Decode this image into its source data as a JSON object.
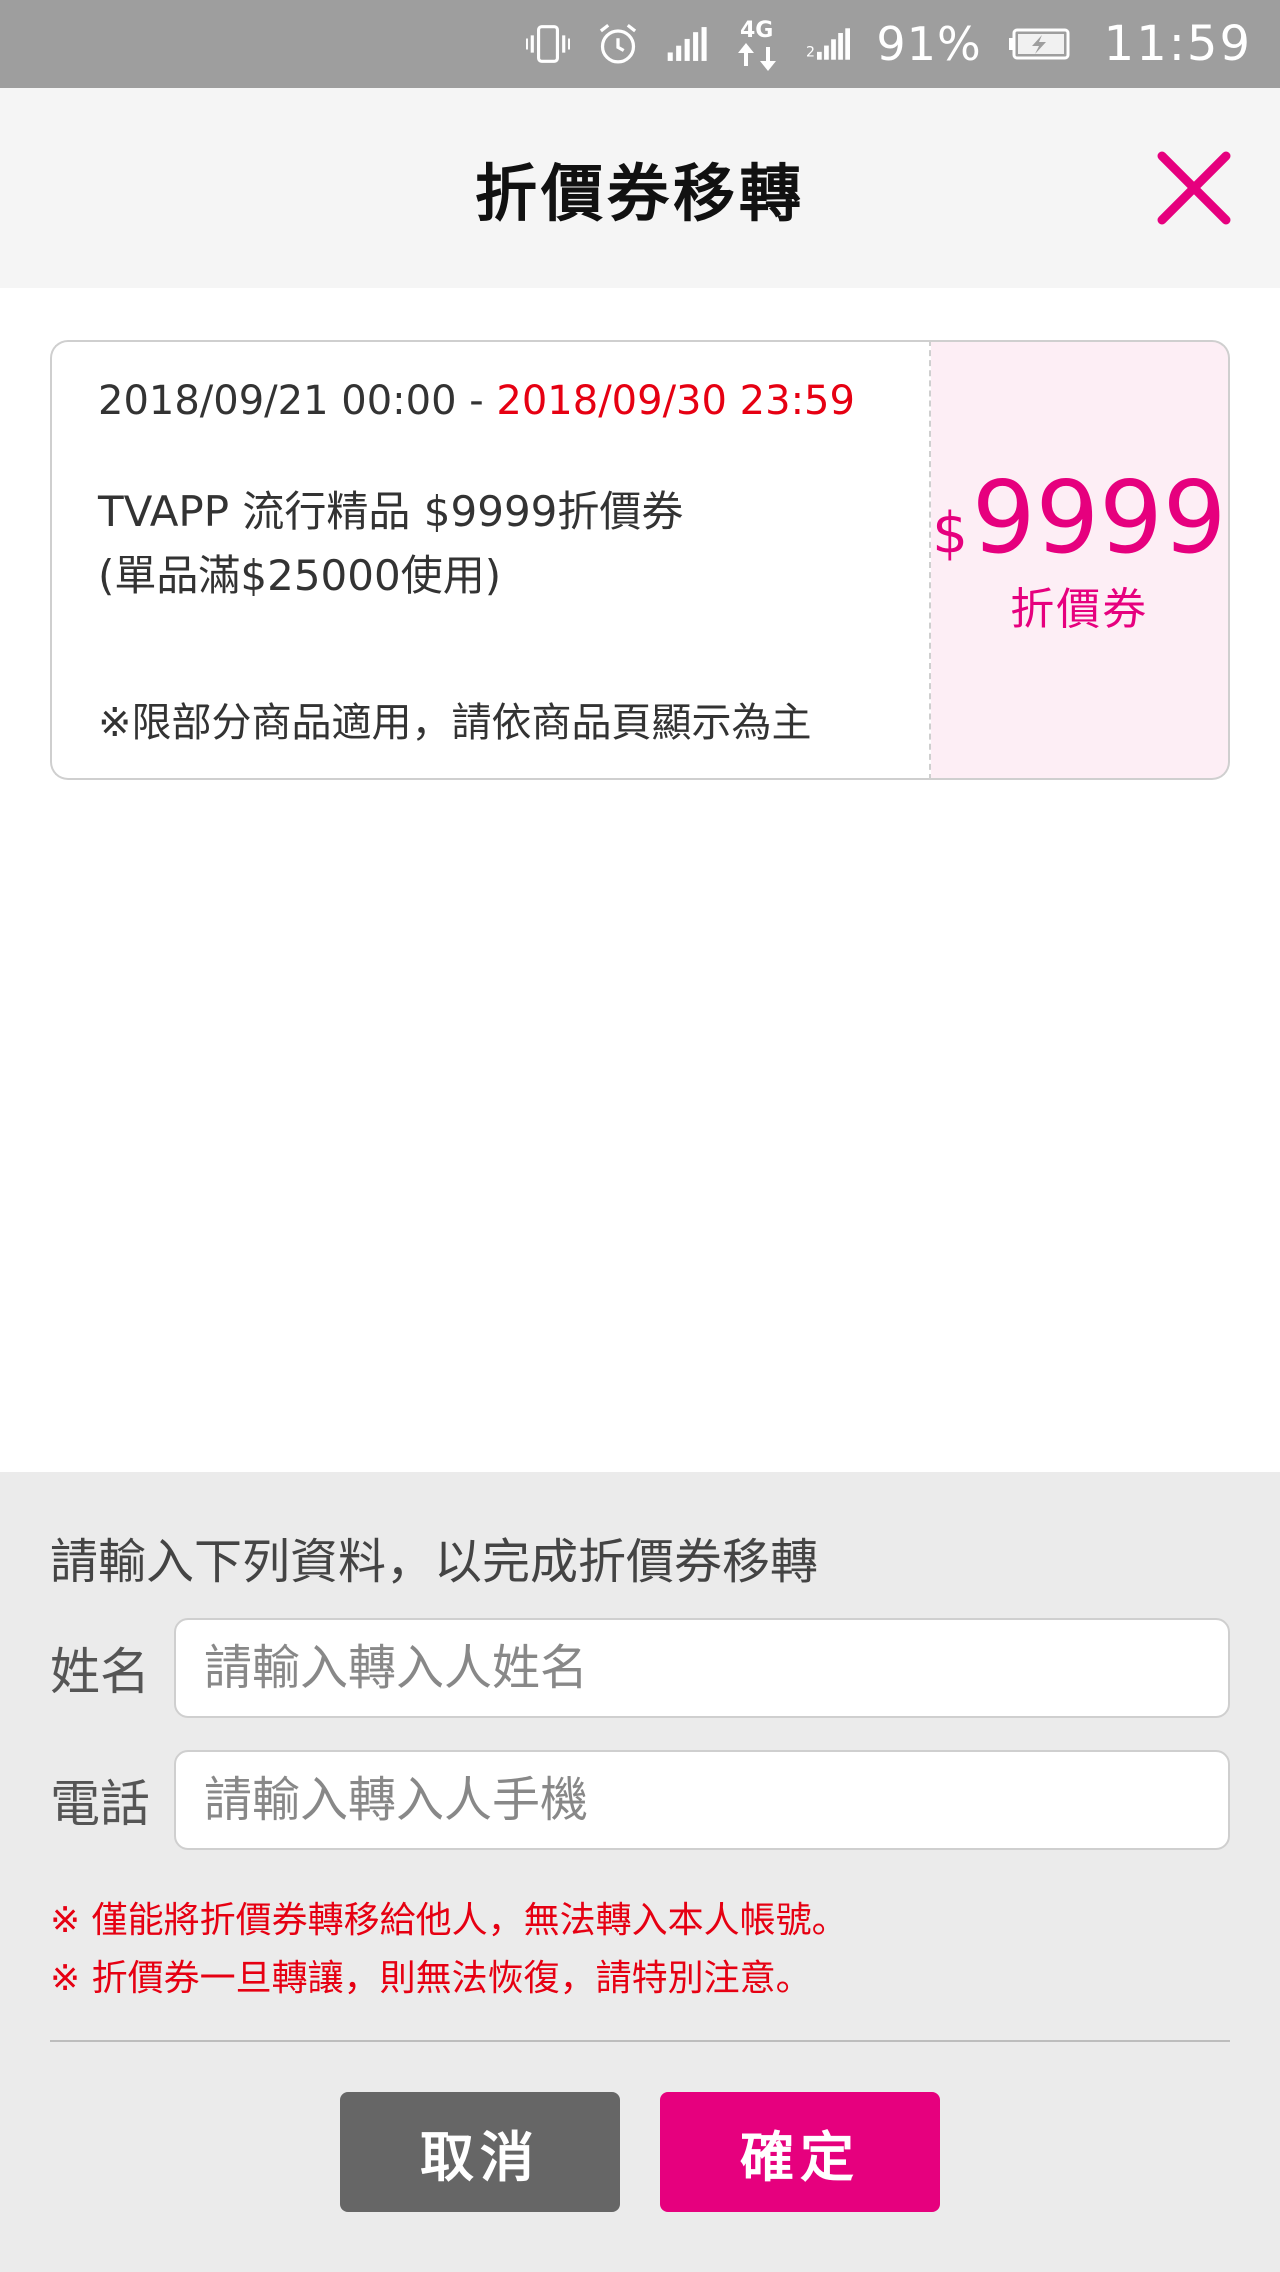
{
  "status_bar": {
    "icons": [
      "vibrate-icon",
      "alarm-icon",
      "signal-icon",
      "data-4g-icon",
      "signal-2-icon",
      "battery-charging-icon"
    ],
    "battery": "91%",
    "time": "11:59"
  },
  "header": {
    "title": "折價券移轉",
    "close_icon": "close-icon",
    "accent_color": "#e6007e"
  },
  "coupon": {
    "date_start": "2018/09/21 00:00 - ",
    "date_end": "2018/09/30 23:59",
    "name_line1": "TVAPP 流行精品 $9999折價券",
    "name_line2": "(單品滿$25000使用)",
    "note": "※限部分商品適用，請依商品頁顯示為主",
    "amount_sign": "$",
    "amount_value": "9999",
    "amount_label": "折價券",
    "date_end_color": "#e60012",
    "panel_color": "#fdeef5"
  },
  "form": {
    "intro": "請輸入下列資料，以完成折價券移轉",
    "name_label": "姓名",
    "name_placeholder": "請輸入轉入人姓名",
    "name_value": "",
    "phone_label": "電話",
    "phone_placeholder": "請輸入轉入人手機",
    "phone_value": "",
    "warning1": "※ 僅能將折價券轉移給他人，無法轉入本人帳號。",
    "warning2": "※ 折價券一旦轉讓，則無法恢復，請特別注意。",
    "cancel_label": "取消",
    "confirm_label": "確定",
    "cancel_color": "#666666",
    "confirm_color": "#e6007e"
  }
}
